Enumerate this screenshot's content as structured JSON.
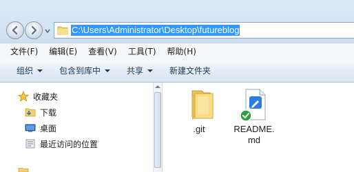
{
  "address": {
    "path": "C:\\Users\\Administrator\\Desktop\\futureblog"
  },
  "menu": {
    "items": [
      "文件(F)",
      "编辑(E)",
      "查看(V)",
      "工具(T)",
      "帮助(H)"
    ]
  },
  "toolbar": {
    "organize_label": "组织",
    "include_label": "包含到库中",
    "share_label": "共享",
    "new_folder_label": "新建文件夹"
  },
  "sidebar": {
    "favorites_label": "收藏夹",
    "items": [
      {
        "label": "下载",
        "icon": "download-folder-icon"
      },
      {
        "label": "桌面",
        "icon": "desktop-icon"
      },
      {
        "label": "最近访问的位置",
        "icon": "recent-places-icon"
      }
    ]
  },
  "files": [
    {
      "name": ".git",
      "icon": "folder-icon"
    },
    {
      "name": "README.md",
      "display": "README.\nmd",
      "icon": "markdown-file-icon"
    }
  ],
  "colors": {
    "selection": "#3399ff",
    "toolbar_text": "#1e3956"
  }
}
